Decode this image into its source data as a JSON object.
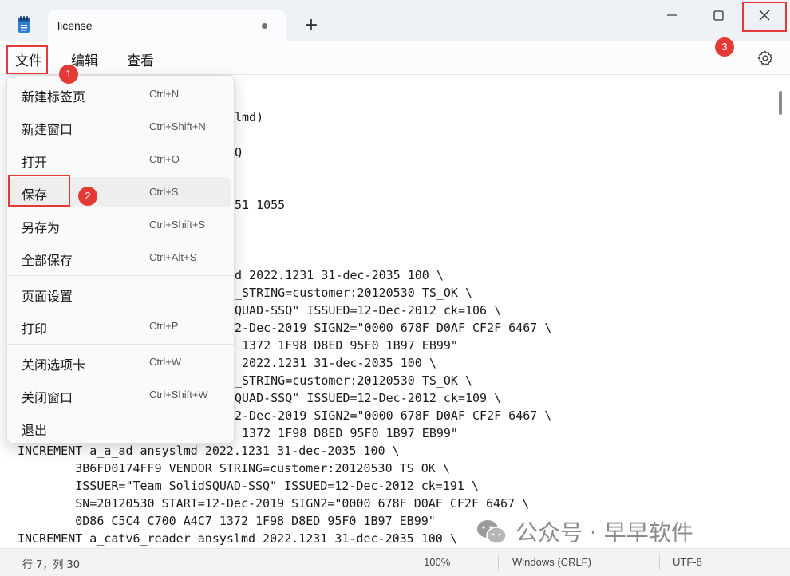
{
  "titlebar": {
    "tab_label": "license",
    "new_tab_symbol": "+",
    "icons": {
      "app": "notepad-icon",
      "minimize": "minimize-icon",
      "maximize": "maximize-icon",
      "close": "close-icon"
    }
  },
  "menubar": {
    "items": [
      "文件",
      "编辑",
      "查看"
    ]
  },
  "annotations": [
    "1",
    "2",
    "3"
  ],
  "dropdown": {
    "items": [
      {
        "label": "新建标签页",
        "shortcut": "Ctrl+N"
      },
      {
        "label": "新建窗口",
        "shortcut": "Ctrl+Shift+N"
      },
      {
        "label": "打开",
        "shortcut": "Ctrl+O"
      },
      {
        "label": "保存",
        "shortcut": "Ctrl+S"
      },
      {
        "label": "另存为",
        "shortcut": "Ctrl+Shift+S"
      },
      {
        "label": "全部保存",
        "shortcut": "Ctrl+Alt+S"
      },
      {
        "label": "页面设置",
        "shortcut": ""
      },
      {
        "label": "打印",
        "shortcut": "Ctrl+P"
      },
      {
        "label": "关闭选项卡",
        "shortcut": "Ctrl+W"
      },
      {
        "label": "关闭窗口",
        "shortcut": "Ctrl+Shift+W"
      },
      {
        "label": "退出",
        "shortcut": ""
      }
    ]
  },
  "editor": {
    "lines": [
      "lmd)",
      "Q",
      "51 1055",
      "d 2022.1231 31-dec-2035 100 \\",
      "_STRING=customer:20120530 TS_OK \\",
      "QUAD-SSQ\" ISSUED=12-Dec-2012 ck=106 \\",
      "2-Dec-2019 SIGN2=\"0000 678F D0AF CF2F 6467 \\",
      " 1372 1F98 D8ED 95F0 1B97 EB99\"",
      " 2022.1231 31-dec-2035 100 \\",
      "_STRING=customer:20120530 TS_OK \\",
      "QUAD-SSQ\" ISSUED=12-Dec-2012 ck=109 \\",
      "2-Dec-2019 SIGN2=\"0000 678F D0AF CF2F 6467 \\",
      " 1372 1F98 D8ED 95F0 1B97 EB99\"",
      "INCREMENT a_a_ad ansyslmd 2022.1231 31-dec-2035 100 \\",
      "        3B6FD0174FF9 VENDOR_STRING=customer:20120530 TS_OK \\",
      "        ISSUER=\"Team SolidSQUAD-SSQ\" ISSUED=12-Dec-2012 ck=191 \\",
      "        SN=20120530 START=12-Dec-2019 SIGN2=\"0000 678F D0AF CF2F 6467 \\",
      "        0D86 C5C4 C700 A4C7 1372 1F98 D8ED 95F0 1B97 EB99\"",
      "INCREMENT a_catv6_reader ansyslmd 2022.1231 31-dec-2035 100 \\"
    ]
  },
  "statusbar": {
    "position": "行 7，列 30",
    "zoom": "100%",
    "line_ending": "Windows (CRLF)",
    "encoding": "UTF-8"
  },
  "watermark": {
    "text": "公众号 · 早早软件"
  }
}
